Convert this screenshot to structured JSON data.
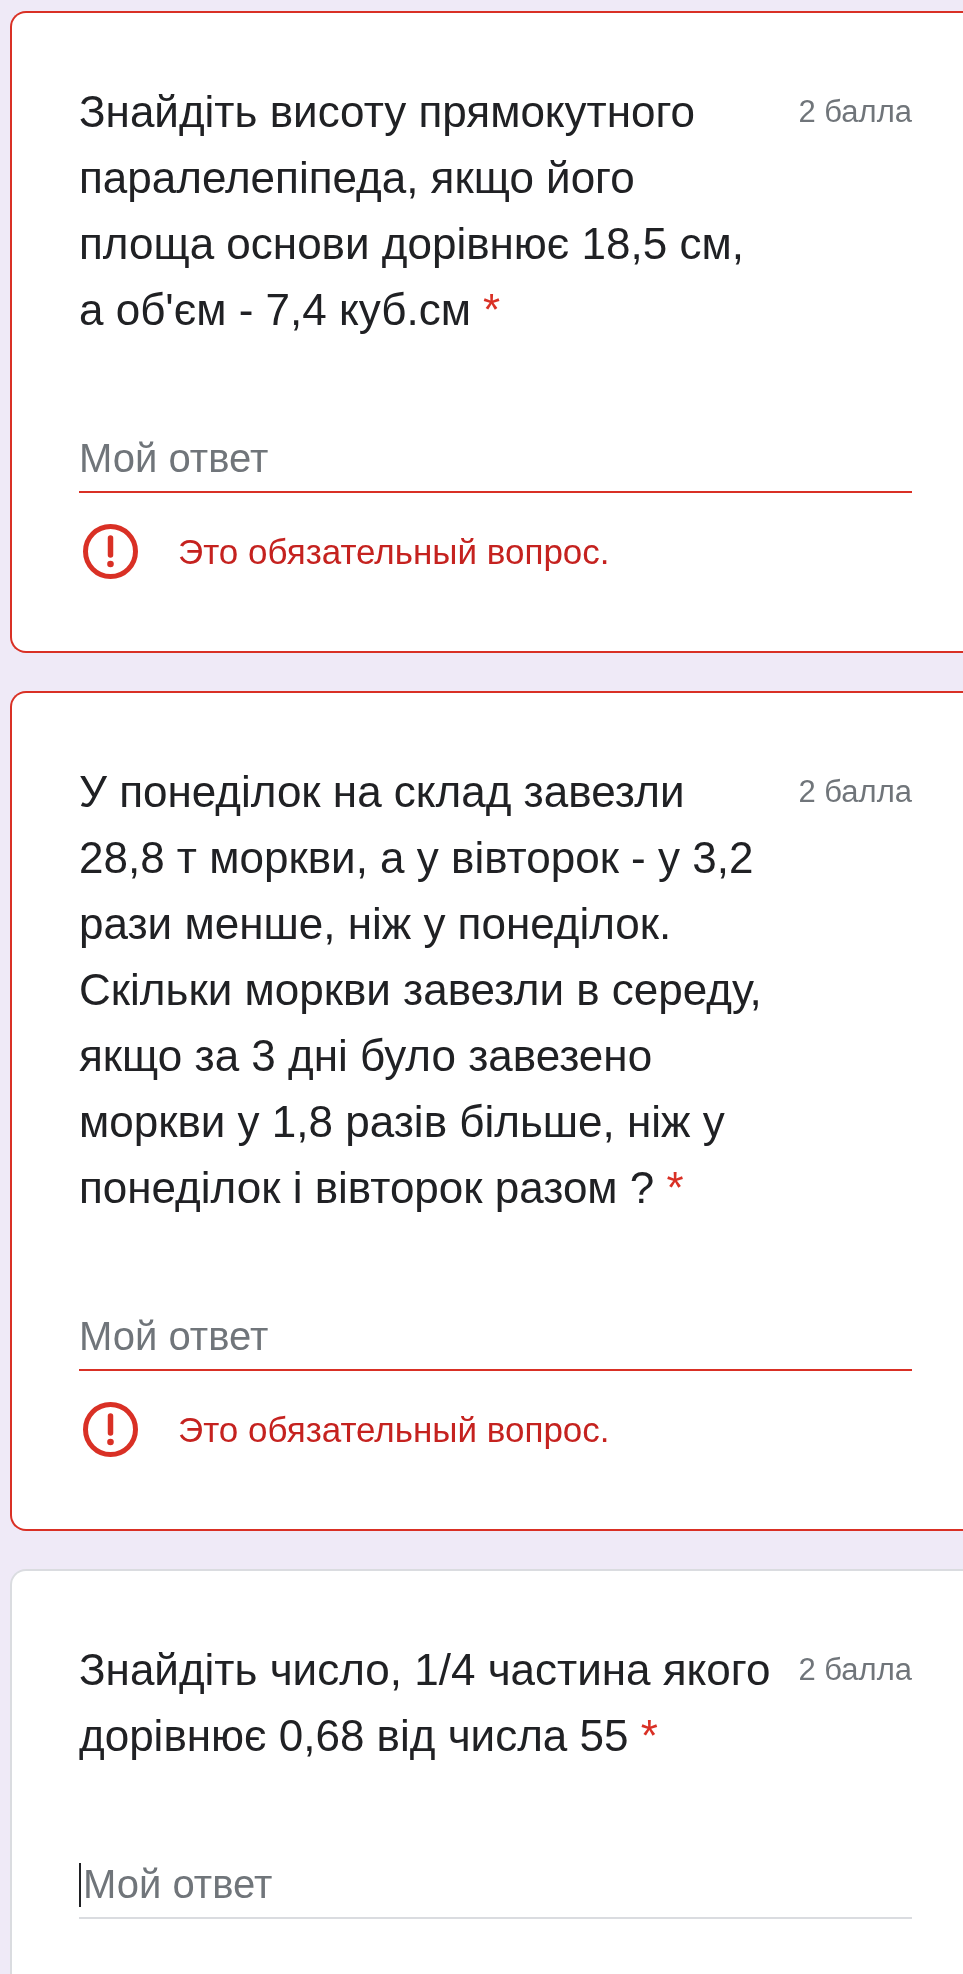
{
  "questions": [
    {
      "text": "Знайдіть висоту прямокутного паралелепіпеда, якщо його площа основи дорівнює 18,5 см, а об'єм - 7,4 куб.см",
      "required_mark": "*",
      "points": "2 балла",
      "answer": {
        "placeholder": "Мой ответ",
        "focused": false
      },
      "error": true,
      "error_message": "Это обязательный вопрос."
    },
    {
      "text": "У понеділок на склад завезли 28,8 т моркви, а у вівторок - у 3,2 рази менше, ніж у понеділок. Скільки моркви завезли в середу, якщо за 3 дні було завезено моркви у 1,8 разів більше, ніж у понеділок і вівторок разом ?",
      "required_mark": "*",
      "points": "2 балла",
      "answer": {
        "placeholder": "Мой ответ",
        "focused": false
      },
      "error": true,
      "error_message": "Это обязательный вопрос."
    },
    {
      "text": "Знайдіть число, 1/4 частина якого дорівнює 0,68 від числа 55",
      "required_mark": "*",
      "points": "2 балла",
      "answer": {
        "placeholder": "Мой ответ",
        "focused": true
      },
      "error": false
    }
  ]
}
